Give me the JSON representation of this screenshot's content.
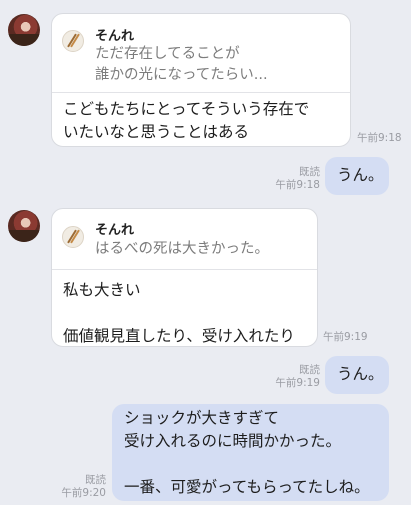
{
  "messages": [
    {
      "sender": "そんれ",
      "quote": {
        "name": "そんれ",
        "text": "ただ存在してることが\n誰かの光になってたらい..."
      },
      "text": "こどもたちにとってそういう存在で\nいたいなと思うことはある",
      "time": "午前9:18"
    },
    {
      "text": "うん。",
      "read": "既読",
      "time": "午前9:18"
    },
    {
      "sender": "そんれ",
      "quote": {
        "name": "そんれ",
        "text": "はるべの死は大きかった。"
      },
      "text": "私も大きい\n\n価値観見直したり、受け入れたり",
      "time": "午前9:19"
    },
    {
      "text": "うん。",
      "read": "既読",
      "time": "午前9:19"
    },
    {
      "text": "ショックが大きすぎて\n受け入れるのに時間かかった。\n\n一番、可愛がってもらってたしね。",
      "read": "既読",
      "time": "午前9:20"
    }
  ]
}
